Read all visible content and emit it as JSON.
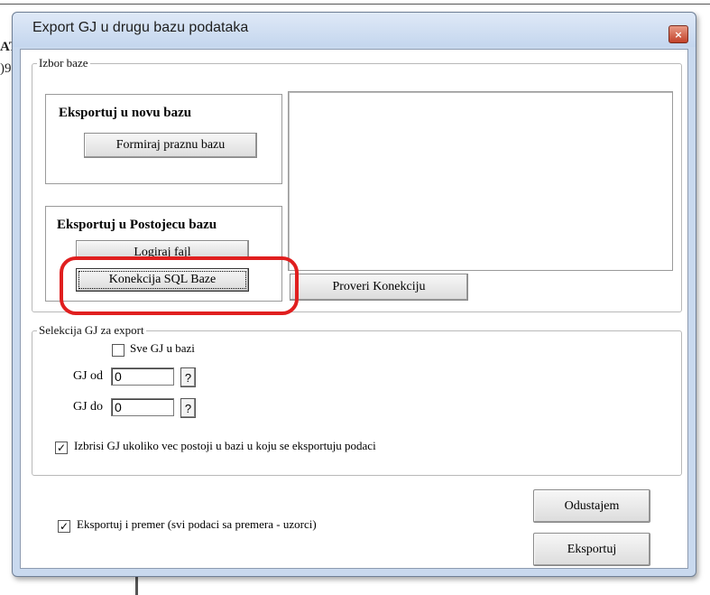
{
  "background": {
    "fragment_top": "AT",
    "fragment_bottom": ")9,"
  },
  "window": {
    "title": "Export GJ u drugu bazu podataka",
    "close_glyph": "×"
  },
  "izbor_baze": {
    "legend": "Izbor baze",
    "nova_baza": {
      "heading": "Eksportuj u novu bazu",
      "button": "Formiraj praznu bazu"
    },
    "postojeca_baza": {
      "heading": "Eksportuj u Postojecu bazu",
      "button_partial": "Logiraj fajl",
      "button_sql": "Konekcija SQL Baze"
    },
    "proveri_button": "Proveri Konekciju"
  },
  "selekcija": {
    "legend": "Selekcija GJ za export",
    "sve_gj": {
      "label": "Sve GJ u bazi",
      "checked": false
    },
    "gj_od": {
      "label": "GJ od",
      "value": "0",
      "lookup": "?"
    },
    "gj_do": {
      "label": "GJ do",
      "value": "0",
      "lookup": "?"
    },
    "izbrisi": {
      "label": "Izbrisi GJ ukoliko vec postoji u bazi u koju se eksportuju podaci",
      "checked": true
    }
  },
  "bottom": {
    "premer": {
      "label": "Eksportuj i premer (svi podaci sa premera -  uzorci)",
      "checked": true
    },
    "odustajem": "Odustajem",
    "eksportuj": "Eksportuj"
  },
  "annotation_color": "#e01f1f"
}
